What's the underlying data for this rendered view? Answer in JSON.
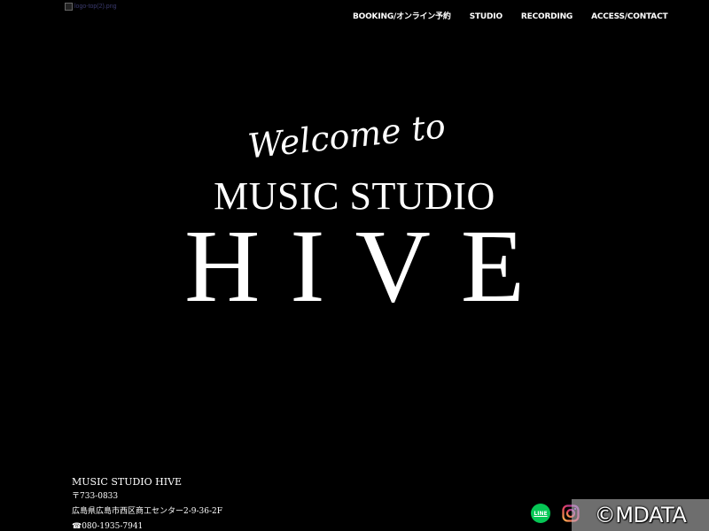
{
  "header": {
    "logo_alt": "logo-top(2).png",
    "nav": [
      {
        "label": "BOOKING/オンライン予約"
      },
      {
        "label": "STUDIO"
      },
      {
        "label": "RECORDING"
      },
      {
        "label": "ACCESS/CONTACT"
      }
    ]
  },
  "hero": {
    "welcome": "Welcome to",
    "line2": "MUSIC STUDIO",
    "line3": "HIVE"
  },
  "footer": {
    "name": "MUSIC STUDIO HIVE",
    "postal": "〒733-0833",
    "address": "広島県広島市西区商工センター2-9-36-2F",
    "phone": "☎080-1935-7941"
  },
  "social": {
    "line_label": "LINE",
    "line_color": "#06c755",
    "instagram_icon": "instagram-icon"
  },
  "watermark": {
    "text": "©MDATA"
  },
  "colors": {
    "background": "#000000",
    "text": "#ffffff"
  }
}
